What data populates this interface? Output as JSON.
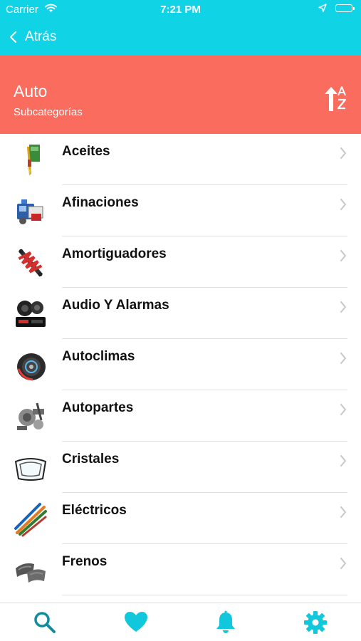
{
  "status_bar": {
    "carrier": "Carrier",
    "time": "7:21 PM"
  },
  "nav": {
    "back_label": "Atrás"
  },
  "header": {
    "title": "Auto",
    "subtitle": "Subcategorías",
    "sort_icon": "sort-alpha-icon"
  },
  "categories": [
    {
      "label": "Aceites",
      "icon": "oil-icon"
    },
    {
      "label": "Afinaciones",
      "icon": "tune-up-kit-icon"
    },
    {
      "label": "Amortiguadores",
      "icon": "shock-absorber-icon"
    },
    {
      "label": "Audio Y Alarmas",
      "icon": "car-audio-icon"
    },
    {
      "label": "Autoclimas",
      "icon": "ac-compressor-icon"
    },
    {
      "label": "Autopartes",
      "icon": "auto-parts-icon"
    },
    {
      "label": "Cristales",
      "icon": "windshield-icon"
    },
    {
      "label": "Eléctricos",
      "icon": "electrical-wires-icon"
    },
    {
      "label": "Frenos",
      "icon": "brake-pads-icon"
    }
  ],
  "tabs": [
    "search-icon",
    "heart-icon",
    "bell-icon",
    "gear-icon"
  ],
  "colors": {
    "nav_bar": "#11d3e6",
    "header": "#fa6c5e",
    "tab_active": "#0f8d9c",
    "tab_inactive": "#11c7dc"
  }
}
